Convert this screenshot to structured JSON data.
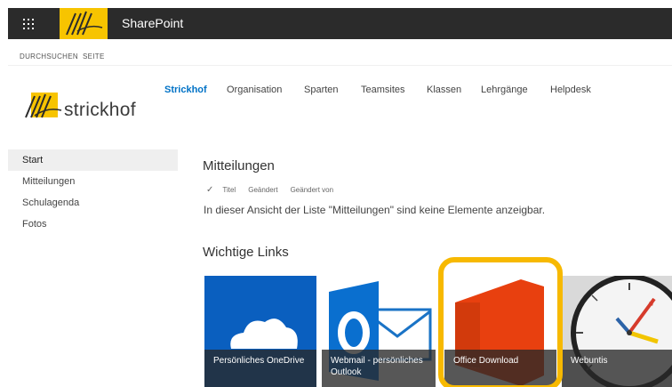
{
  "suitebar": {
    "title": "SharePoint",
    "waffle_icon": "waffle-icon",
    "logo_icon": "strickhof-logo"
  },
  "ribbon": {
    "tabs": [
      "DURCHSUCHEN",
      "SEITE"
    ]
  },
  "site": {
    "logo_text": "strickhof"
  },
  "topnav": [
    "Strickhof",
    "Organisation",
    "Sparten",
    "Teamsites",
    "Klassen",
    "Lehrgänge",
    "Helpdesk"
  ],
  "leftnav": [
    "Start",
    "Mitteilungen",
    "Schulagenda",
    "Fotos"
  ],
  "mitteilungen": {
    "title": "Mitteilungen",
    "columns": [
      "Titel",
      "Geändert",
      "Geändert von"
    ],
    "empty_message": "In dieser Ansicht der Liste \"Mitteilungen\" sind keine Elemente anzeigbar."
  },
  "links": {
    "title": "Wichtige Links",
    "tiles": [
      {
        "label": "Persönliches OneDrive",
        "icon": "onedrive-icon",
        "color": "#0a5fbf"
      },
      {
        "label": "Webmail - persönliches Outlook",
        "icon": "outlook-icon",
        "color": "#ffffff"
      },
      {
        "label": "Office Download",
        "icon": "office-icon",
        "color": "#ffffff"
      },
      {
        "label": "Webuntis",
        "icon": "clock-icon",
        "color": "#d9d9d9"
      }
    ]
  },
  "accent": {
    "brand_yellow": "#f7c400",
    "link_blue": "#0072c6",
    "highlight": "#f7b900"
  }
}
